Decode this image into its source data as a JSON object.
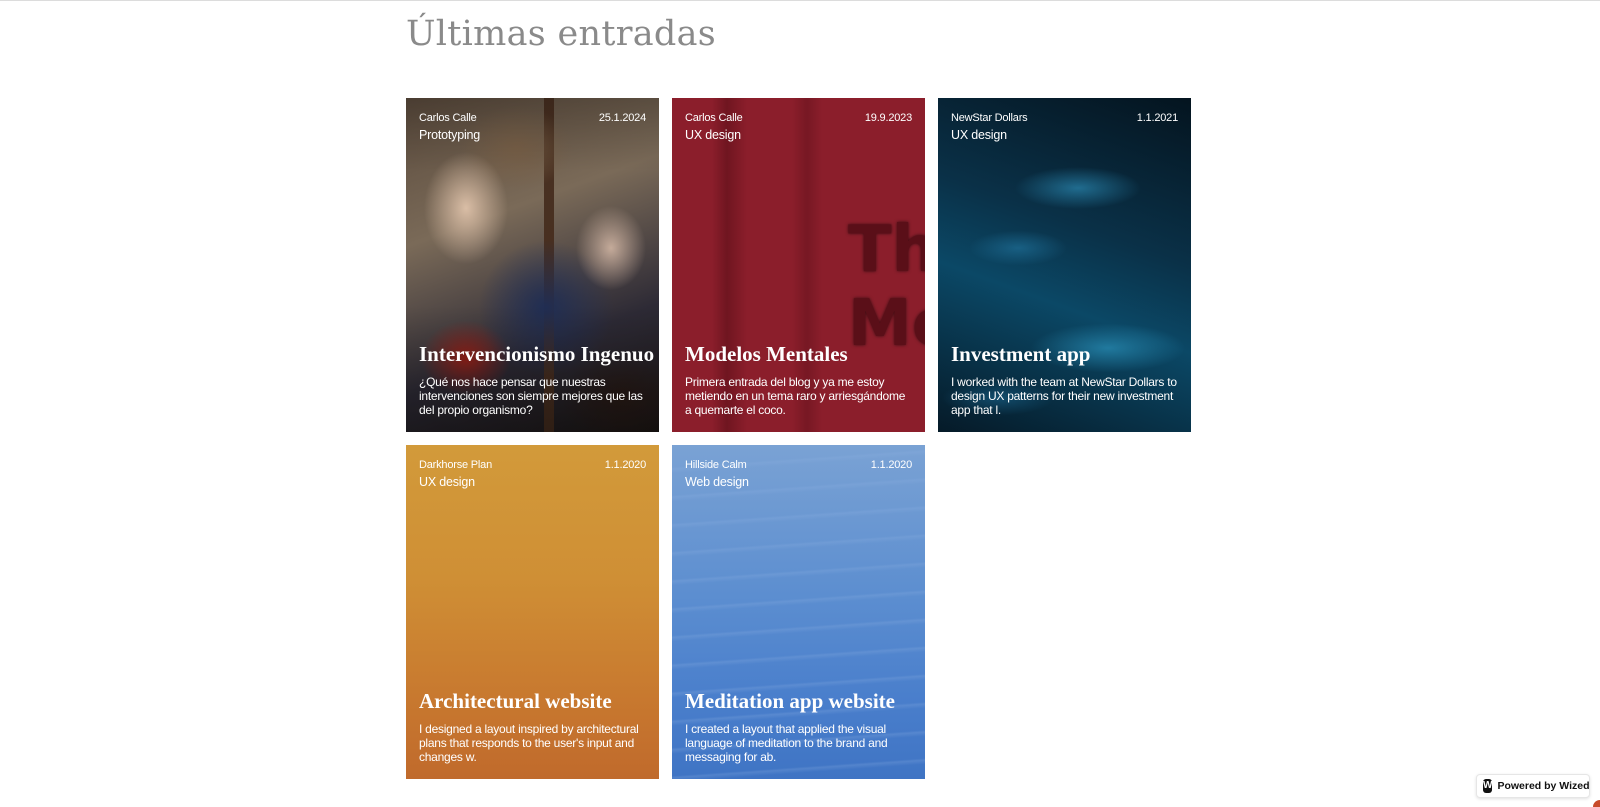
{
  "section": {
    "title": "Últimas entradas"
  },
  "cards": [
    {
      "author": "Carlos Calle",
      "date": "25.1.2024",
      "category": "Prototyping",
      "title": "Intervencionismo Ingenuo",
      "description": "¿Qué nos hace pensar que nuestras intervenciones son siempre mejores que las del propio organismo?",
      "image": "renaissance-painting"
    },
    {
      "author": "Carlos Calle",
      "date": "19.9.2023",
      "category": "UX design",
      "title": "Modelos Mentales",
      "description": "Primera entrada del blog y ya me estoy metiendo en un tema raro y arriesgándome a quemarte el coco.",
      "image": "red-cover",
      "image_text": [
        "Th",
        "Me"
      ]
    },
    {
      "author": "NewStar Dollars",
      "date": "1.1.2021",
      "category": "UX design",
      "title": "Investment app",
      "description": "I worked with the team at NewStar Dollars to design UX patterns for their new investment app that l.",
      "image": "ocean-texture"
    },
    {
      "author": "Darkhorse Plan",
      "date": "1.1.2020",
      "category": "UX design",
      "title": "Architectural website",
      "description": "I designed a layout inspired by architectural plans that responds to the user's input and changes w.",
      "image": "orange-gradient"
    },
    {
      "author": "Hillside Calm",
      "date": "1.1.2020",
      "category": "Web design",
      "title": "Meditation app website",
      "description": "I created a layout that applied the visual language of meditation to the brand and messaging for ab.",
      "image": "blue-mountains"
    }
  ],
  "badge": {
    "icon": "W",
    "label": "Powered by Wized"
  },
  "colors": {
    "title_gray": "#8a8a8a",
    "red_card": "#8b1e2b",
    "orange_card": "#cf8f35",
    "blue_card": "#5c8ed0",
    "ocean_card": "#0b4866"
  }
}
